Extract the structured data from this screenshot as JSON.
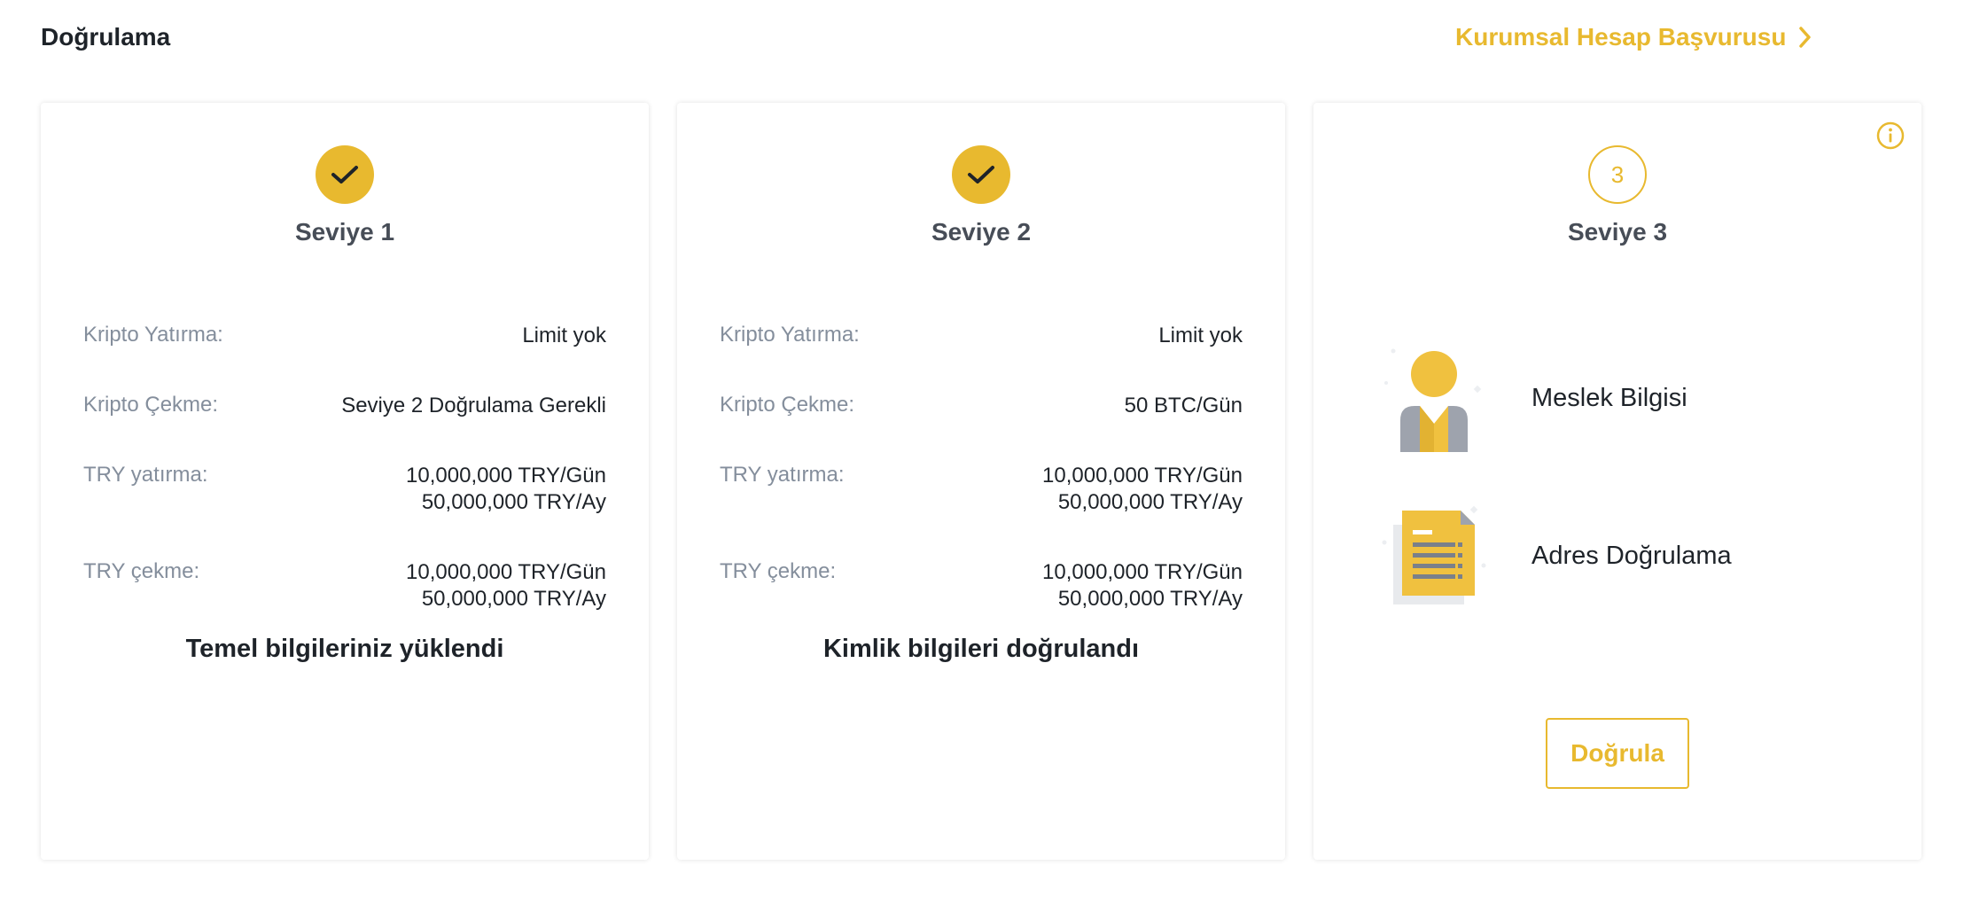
{
  "header": {
    "title": "Doğrulama",
    "corporate_link": "Kurumsal Hesap Başvurusu"
  },
  "colors": {
    "accent": "#e8b92f",
    "text": "#1e2329",
    "muted": "#848e9c"
  },
  "levels": [
    {
      "title": "Seviye 1",
      "status": "completed",
      "rows": [
        {
          "label": "Kripto Yatırma:",
          "value": "Limit yok"
        },
        {
          "label": "Kripto Çekme:",
          "value": "Seviye 2 Doğrulama Gerekli"
        },
        {
          "label": "TRY yatırma:",
          "value_day": "10,000,000 TRY/Gün",
          "value_month": "50,000,000 TRY/Ay"
        },
        {
          "label": "TRY çekme:",
          "value_day": "10,000,000 TRY/Gün",
          "value_month": "50,000,000 TRY/Ay"
        }
      ],
      "footer": "Temel bilgileriniz yüklendi"
    },
    {
      "title": "Seviye 2",
      "status": "completed",
      "rows": [
        {
          "label": "Kripto Yatırma:",
          "value": "Limit yok"
        },
        {
          "label": "Kripto Çekme:",
          "value": "50 BTC/Gün"
        },
        {
          "label": "TRY yatırma:",
          "value_day": "10,000,000 TRY/Gün",
          "value_month": "50,000,000 TRY/Ay"
        },
        {
          "label": "TRY çekme:",
          "value_day": "10,000,000 TRY/Gün",
          "value_month": "50,000,000 TRY/Ay"
        }
      ],
      "footer": "Kimlik bilgileri doğrulandı"
    },
    {
      "title": "Seviye 3",
      "status": "pending",
      "number": "3",
      "requirements": [
        {
          "label": "Meslek Bilgisi",
          "icon": "person-icon"
        },
        {
          "label": "Adres Doğrulama",
          "icon": "document-icon"
        }
      ],
      "button": "Doğrula"
    }
  ]
}
